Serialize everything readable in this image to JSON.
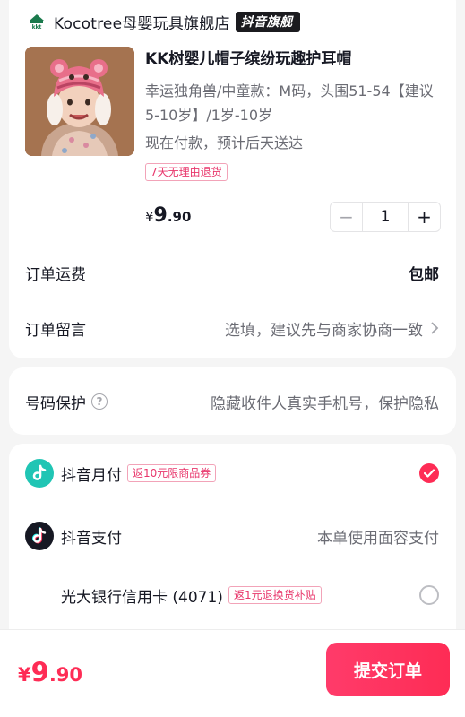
{
  "shop": {
    "name": "Kocotree母婴玩具旗舰店",
    "badge": "抖音旗舰"
  },
  "product": {
    "image_icon": "baby-hat-photo",
    "title": "KK树婴儿帽子缤纷玩趣护耳帽",
    "spec": "幸运独角兽/中童款：M码，头围51-54【建议5-10岁】/1岁-10岁",
    "shipping": "现在付款，预计后天送达",
    "tag": "7天无理由退货",
    "price_symbol": "¥",
    "price_int": "9",
    "price_dec": ".90",
    "quantity": "1",
    "minus_label": "−",
    "plus_label": "+"
  },
  "order": {
    "freight_label": "订单运费",
    "freight_value": "包邮",
    "message_label": "订单留言",
    "message_placeholder": "选填，建议先与商家协商一致"
  },
  "protection": {
    "label": "号码保护",
    "help_glyph": "?",
    "value": "隐藏收件人真实手机号，保护隐私"
  },
  "payment": {
    "monthly": {
      "label": "抖音月付",
      "tag": "返10元限商品券",
      "selected": true
    },
    "douyin_pay": {
      "label": "抖音支付",
      "value": "本单使用面容支付"
    },
    "bank_card": {
      "label": "光大银行信用卡 (4071)",
      "tag": "返1元退换货补贴",
      "selected": false
    }
  },
  "footer": {
    "total_symbol": "¥",
    "total_int": "9",
    "total_dec": ".90",
    "submit_label": "提交订单"
  },
  "colors": {
    "accent": "#fe2c55",
    "tag_text": "#e8366b",
    "secondary_text": "#6b6c74",
    "pay_monthly_icon": "#20c5b4",
    "pay_douyin_icon": "#161823"
  }
}
